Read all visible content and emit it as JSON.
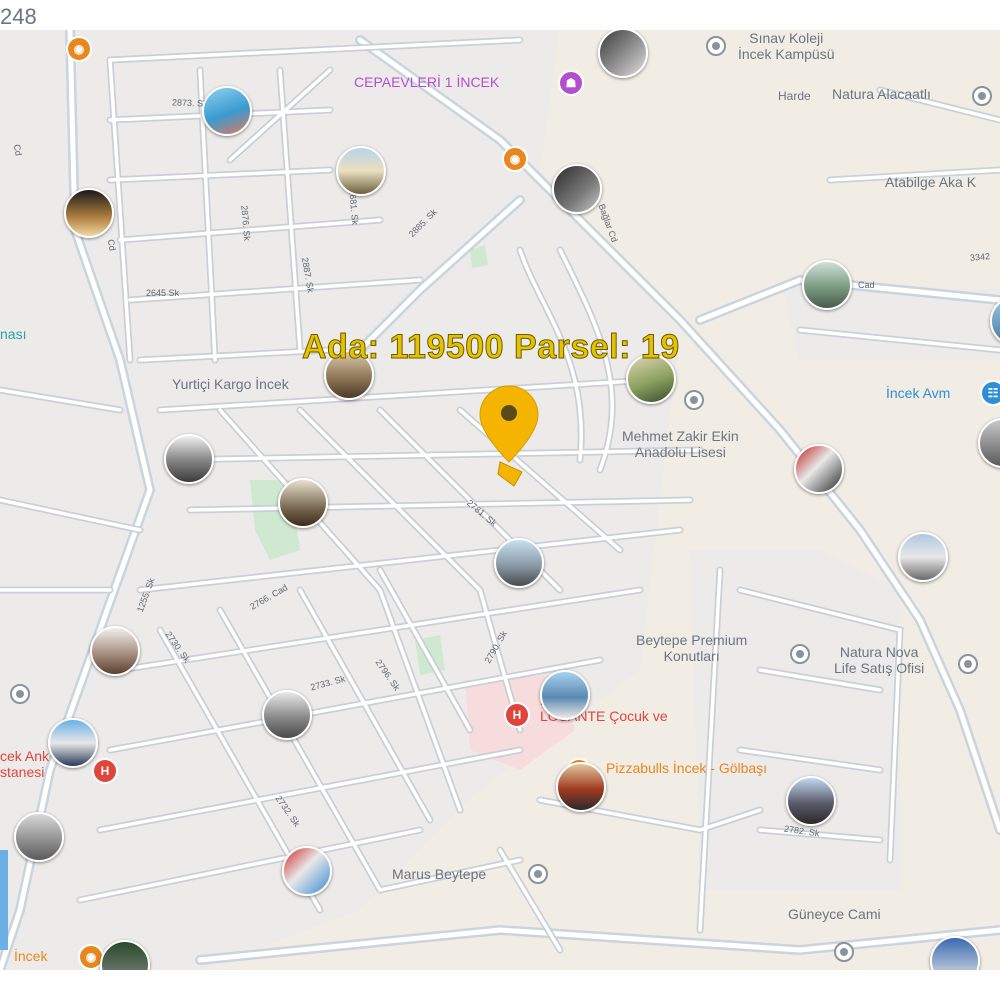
{
  "corner_number": "248",
  "parcel_label": "Ada: 119500  Parsel: 19",
  "places": {
    "sinav_koleji": "Sınav Koleji\nİncek Kampüsü",
    "natura": "Natura Alacaatlı",
    "cepa": "CEPAEVLERİ 1 İNCEK",
    "atabilge": "Atabilge Aka K",
    "yurtici": "Yurtiçi Kargo İncek",
    "incek_avm": "İncek Avm",
    "mehmet_zakir": "Mehmet Zakir Ekin\nAnadolu Lisesi",
    "beytepe_premium": "Beytepe Premium\nKonutları",
    "natura_nova": "Natura Nova\nLife Satış Ofisi",
    "losev": "LÖSEV\nLÖSANTE Çocuk ve",
    "pizzabulls": "Pizzabulls İncek - Gölbaşı",
    "marus": "Marus Beytepe",
    "guneyce": "Güneyce Cami",
    "incek_anka": "cek Ank\nstanesi",
    "incek_bottom": "İncek",
    "edge_left": "nası",
    "harde": "Harde"
  },
  "streets": [
    "2873. Sk",
    "2876. Sk",
    "2645 Sk",
    "2887. Sk",
    "2885. Sk",
    "2681. Sk",
    "2781. Sk",
    "2790. Sk",
    "2796. Sk",
    "2730. Sk",
    "2766. Cad",
    "1255. Sk",
    "2733. Sk",
    "2732. Sk",
    "Cd",
    "2782. Sk",
    "Cd",
    "Bağlar Cd",
    "3342",
    "Cad"
  ],
  "colors": {
    "land": "#f1ede4",
    "residential": "#ece9e4",
    "road": "#ffffff",
    "major_road": "#c9d4dd",
    "park": "#cfe8d0",
    "hospital_area": "#f6dcdc",
    "marker": "#f5b400",
    "parcel": "#f5b400"
  },
  "icons": [
    "location-pin-icon",
    "photo-thumbnail-icon",
    "restaurant-icon",
    "hospital-icon",
    "school-icon",
    "shopping-icon",
    "place-icon"
  ]
}
